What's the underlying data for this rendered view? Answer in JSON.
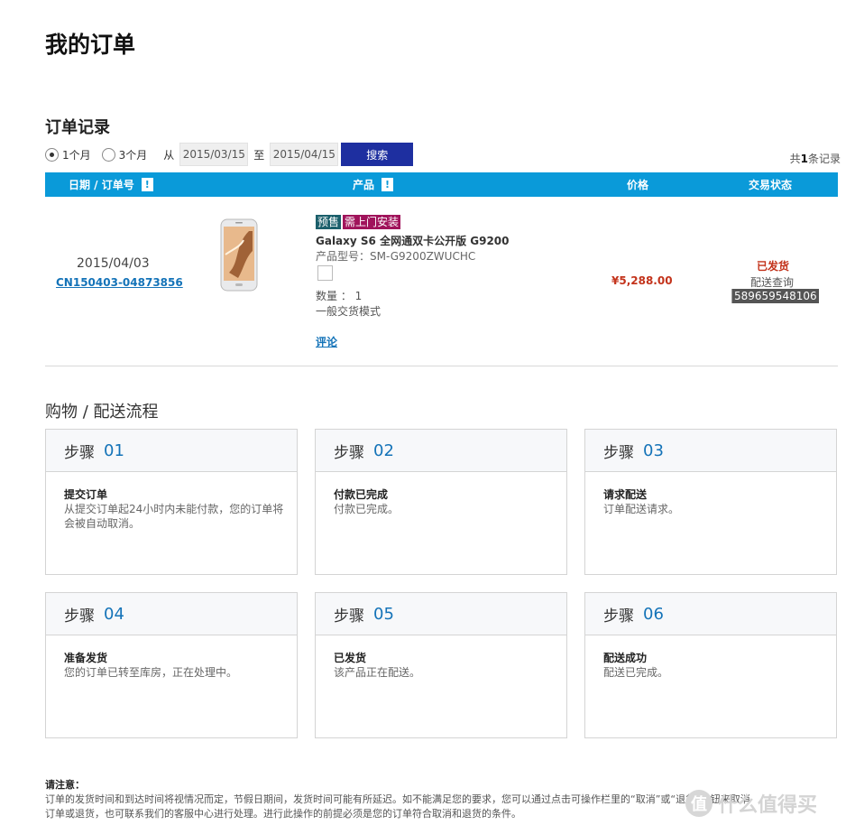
{
  "page": {
    "title": "我的订单"
  },
  "records": {
    "title": "订单记录",
    "filters": {
      "option_1m": "1个月",
      "option_3m": "3个月",
      "from_label": "从",
      "start_date": "2015/03/15",
      "to_label": "至",
      "end_date": "2015/04/15",
      "search_label": "搜索"
    },
    "count_prefix": "共",
    "count": "1",
    "count_suffix": "条记录"
  },
  "table": {
    "headers": [
      "日期 / 订单号",
      "产品",
      "价格",
      "交易状态"
    ],
    "warn_glyph": "!"
  },
  "order": {
    "date": "2015/04/03",
    "order_no": "CN150403-04873856",
    "badges": [
      "预售",
      "需上门安装"
    ],
    "product_name": "Galaxy S6 全网通双卡公开版 G9200",
    "model": "产品型号：SM-G9200ZWUCHC",
    "qty": "数量 ： 1",
    "trade_mode": "一般交货模式",
    "review_label": "评论",
    "price": "¥5,288.00",
    "status": "已发货",
    "track_label": "配送查询",
    "tracking_no": "589659548106"
  },
  "flow": {
    "title": "购物 / 配送流程",
    "step_word": "步骤",
    "steps": [
      {
        "num": "01",
        "name": "提交订单",
        "desc": "从提交订单起24小时内未能付款，您的订单将会被自动取消。"
      },
      {
        "num": "02",
        "name": "付款已完成",
        "desc": "付款已完成。"
      },
      {
        "num": "03",
        "name": "请求配送",
        "desc": "订单配送请求。"
      },
      {
        "num": "04",
        "name": "准备发货",
        "desc": "您的订单已转至库房，正在处理中。"
      },
      {
        "num": "05",
        "name": "已发货",
        "desc": "该产品正在配送。"
      },
      {
        "num": "06",
        "name": "配送成功",
        "desc": "配送已完成。"
      }
    ]
  },
  "notice": {
    "title": "请注意：",
    "line1": "订单的发货时间和到达时间将视情况而定，节假日期间，发货时间可能有所延迟。如不能满足您的要求，您可以通过点击可操作栏里的“取消”或“退货”按钮来取消",
    "line2": "订单或退货，也可联系我们的客服中心进行处理。进行此操作的前提必须是您的订单符合取消和退货的条件。"
  },
  "watermark": {
    "glyph": "值",
    "text": "什么值得买"
  },
  "colors": {
    "header_blue": "#0a9ad9",
    "button_navy": "#1e2fa0",
    "price_red": "#c3331b",
    "link_blue": "#1473b8"
  }
}
